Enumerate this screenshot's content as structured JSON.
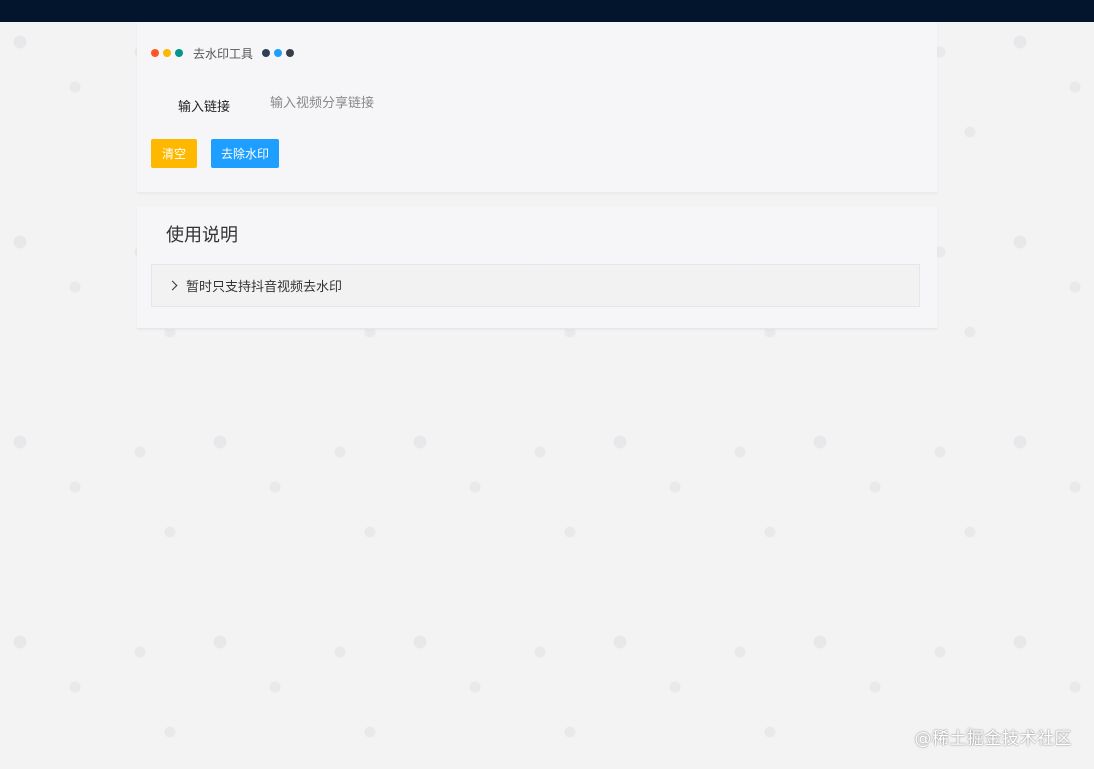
{
  "header": {
    "title": "去水印工具",
    "dots_left": [
      "#ff5722",
      "#ffb800",
      "#009688"
    ],
    "dots_right": [
      "#2f4056",
      "#1e9fff",
      "#393d49"
    ]
  },
  "form": {
    "input_label": "输入链接",
    "input_placeholder": "输入视频分享链接",
    "clear_label": "清空",
    "remove_label": "去除水印"
  },
  "help": {
    "title": "使用说明",
    "items": [
      {
        "label": "暂时只支持抖音视频去水印"
      }
    ]
  },
  "watermark": "@稀土掘金技术社区",
  "colors": {
    "topbar": "#02152c",
    "clear_button": "#ffb800",
    "remove_button": "#1e9fff"
  }
}
